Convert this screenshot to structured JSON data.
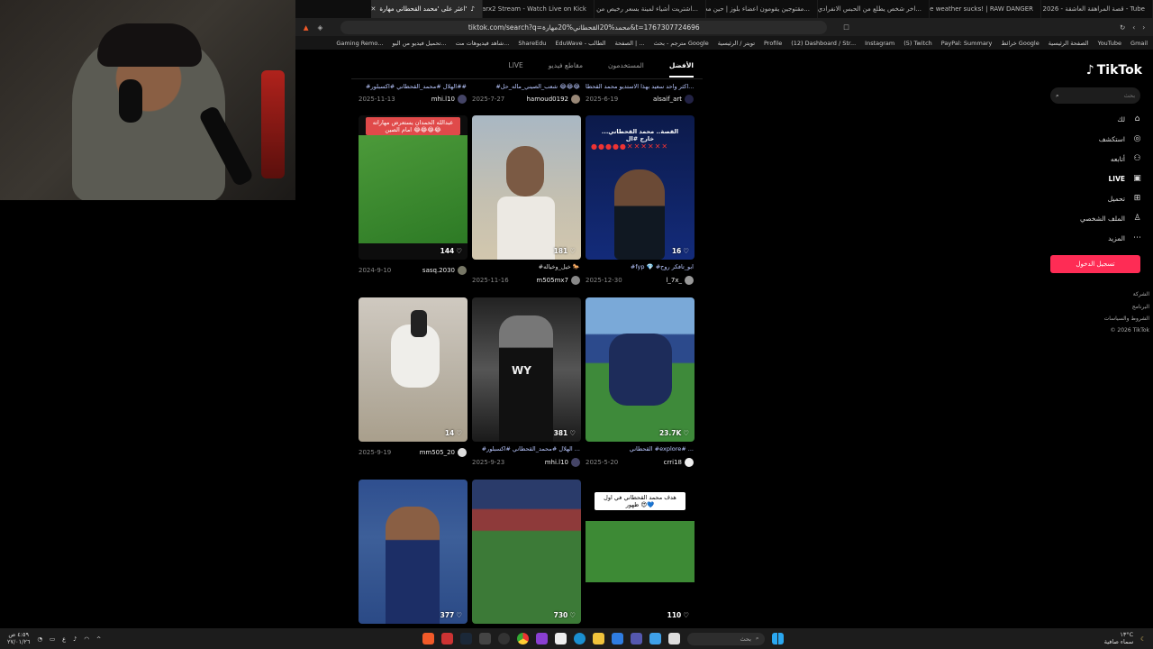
{
  "browser": {
    "tabs": [
      {
        "title": "2026 - قصة المراهقة العاشقة - Tube",
        "yt": true
      },
      {
        "title": "The weather sucks! | RAW DANGER",
        "yt": true
      },
      {
        "title": "اخر شخص يطلع من الحبس الانفرادي يا...",
        "yt": true
      },
      {
        "title": "مقتوجين يقومون اعضاء بلوز | حين معنا...",
        "yt": true
      },
      {
        "title": "اشتريت أشياء لمينة بسعر رخيص من بـ...",
        "yt": true
      },
      {
        "title": "narx2 Stream - Watch Live on Kick",
        "yt": false
      },
      {
        "title": "اعثر على 'محمد القحطاني مهارة'",
        "yt": false,
        "active": true
      }
    ],
    "url": "tiktok.com/search?q=محمد%20القحطاني%20مهارة&t=1767307724696",
    "bookmarks": [
      "Gmail",
      "YouTube",
      "الصفحة الرئيسية",
      "خرائط Google",
      "PayPal: Summary",
      "(5) Twitch",
      "Instagram",
      "(12) Dashboard / Str...",
      "Profile",
      "تويتر / الرئيسية",
      "مترجم - بحث Google",
      "الصفحة | ...",
      "EduWave - الطالب",
      "ShareEdu",
      "شاهد فيديوهات مت...",
      "تحميل فيديو من اليو...",
      "Gaming Remo..."
    ]
  },
  "sidebar": {
    "logo": "TikTok",
    "search_placeholder": "بحث",
    "nav": [
      {
        "label": "لك",
        "icon": "home-icon"
      },
      {
        "label": "استكشف",
        "icon": "compass-icon"
      },
      {
        "label": "أتابعه",
        "icon": "following-icon"
      },
      {
        "label": "LIVE",
        "icon": "live-icon"
      },
      {
        "label": "تحميل",
        "icon": "upload-icon"
      },
      {
        "label": "الملف الشخصي",
        "icon": "profile-icon"
      },
      {
        "label": "المزيد",
        "icon": "more-icon"
      }
    ],
    "login": "تسجيل الدخول",
    "footer": [
      "الشركة",
      "البرنامج",
      "الشروط والسياسات",
      "© 2026 TikTok"
    ]
  },
  "results": {
    "tabs": [
      "الأفضل",
      "المستخدمون",
      "مقاطع فيديو",
      "LIVE"
    ],
    "row0": [
      {
        "caption": "#الهلال #محمد_القحطاني #اكسبلور##",
        "user": "mhi.l10",
        "date": "2025-11-13"
      },
      {
        "caption": "#شعب_الصيني_ماله_حل 😂😂😂",
        "user": "hamoud0192",
        "date": "2025-7-27"
      },
      {
        "caption": "اكثر واحد سعيد بهذا الاستديو محمد القحطا...",
        "user": "alsaif_art",
        "date": "2025-6-19"
      }
    ],
    "row1": [
      {
        "overlay": "عبدالله الحمدان يستعرض مهاراته امام الصين 😂😂😂😂",
        "likes": "144",
        "caption": "",
        "user": "sasq.2030",
        "date": "2024-9-10"
      },
      {
        "overlay": "",
        "likes": "181",
        "caption": "#خيل_وخياله 🐎",
        "user": "m505mx7",
        "date": "2025-11-16"
      },
      {
        "overlay": "...القصة.. محمد القحطاني خارج #ال",
        "likes": "16",
        "caption": "#fyp 💎 #ابو_تافكر روح",
        "user": "l_7x_",
        "date": "2025-12-30"
      }
    ],
    "row2": [
      {
        "likes": "14",
        "caption": "",
        "user": "mm505_20",
        "date": "2025-9-19"
      },
      {
        "likes": "381",
        "caption": "#الهلال #محمد_القحطاني #اكسبلور ...",
        "user": "mhi.l10",
        "date": "2025-9-23"
      },
      {
        "likes": "23.7K",
        "caption": "القحطاني #explore# ...",
        "user": "crri18",
        "date": "2025-5-20"
      }
    ],
    "row3": [
      {
        "likes": "377"
      },
      {
        "likes": "730"
      },
      {
        "overlay": "هدف محمد القحطاني في اول ظهور 😍💙",
        "likes": "110"
      }
    ]
  },
  "taskbar": {
    "search": "بحث",
    "weather": "١٣°C",
    "weather_note": "سماء صافية",
    "time": "٤:٥٩ ص",
    "date": "٢٧/٠١/٢٦",
    "lang": "ع"
  },
  "colors": {
    "accent": "#fe2c55",
    "link": "#b9c7ff"
  }
}
